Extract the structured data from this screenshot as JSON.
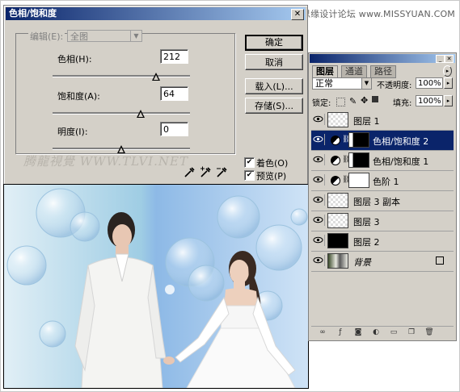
{
  "watermark_header": "思缘设计论坛 www.MISSYUAN.COM",
  "dialog": {
    "title": "色相/饱和度",
    "edit_label": "编辑(E):",
    "edit_value": "全图",
    "hue_label": "色相(H):",
    "hue_value": "212",
    "saturation_label": "饱和度(A):",
    "saturation_value": "64",
    "lightness_label": "明度(I):",
    "lightness_value": "0",
    "hue_slider_level": 0.75,
    "saturation_slider_level": 0.64,
    "lightness_slider_level": 0.5,
    "buttons": {
      "ok": "确定",
      "cancel": "取消",
      "load": "载入(L)...",
      "save": "存储(S)..."
    },
    "colorize_label": "着色(O)",
    "colorize_checked": true,
    "preview_label": "预览(P)",
    "preview_checked": true,
    "watermark": "腾龍視覺 WWW.TLVI.NET"
  },
  "layers_panel": {
    "tabs": [
      "图层",
      "通道",
      "路径"
    ],
    "blend_mode": "正常",
    "opacity_label": "不透明度:",
    "opacity_value": "100%",
    "lock_label": "锁定:",
    "fill_label": "填充:",
    "fill_value": "100%",
    "layers": [
      {
        "name": "图层 1",
        "kind": "pixel",
        "selected": false
      },
      {
        "name": "色相/饱和度 2",
        "kind": "adjustment",
        "mask": "black",
        "selected": true
      },
      {
        "name": "色相/饱和度 1",
        "kind": "adjustment",
        "mask": "black",
        "selected": false
      },
      {
        "name": "色阶 1",
        "kind": "adjustment",
        "mask": "white",
        "selected": false
      },
      {
        "name": "图层 3 副本",
        "kind": "pixel",
        "selected": false
      },
      {
        "name": "图层 3",
        "kind": "pixel",
        "selected": false
      },
      {
        "name": "图层 2",
        "kind": "pixel",
        "selected": false
      },
      {
        "name": "背景",
        "kind": "background",
        "selected": false
      }
    ]
  },
  "colors": {
    "title_bar": "#0a246a",
    "dialog_bg": "#d4d0c8",
    "selection": "#0a246a"
  }
}
